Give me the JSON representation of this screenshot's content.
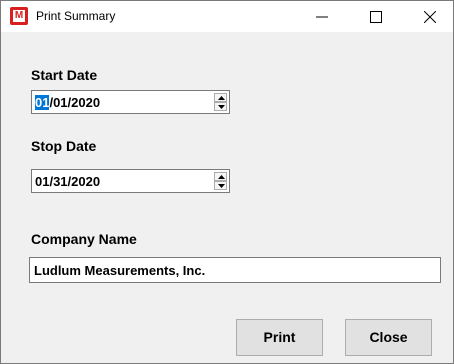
{
  "window": {
    "title": "Print Summary",
    "app_icon_letter": "M",
    "app_icon_color": "#d81e1e",
    "buttons": [
      "minimize-icon",
      "maximize-icon",
      "close-icon"
    ]
  },
  "form": {
    "start_date": {
      "label": "Start Date",
      "value_selected": "01",
      "value_rest": "/01/2020"
    },
    "stop_date": {
      "label": "Stop Date",
      "value": "01/31/2020"
    },
    "company": {
      "label": "Company Name",
      "value": "Ludlum Measurements, Inc."
    }
  },
  "actions": {
    "print_label": "Print",
    "close_label": "Close"
  },
  "colors": {
    "selection": "#0078d7",
    "dialog_bg": "#f0f0f0",
    "button_bg": "#e1e1e1"
  }
}
